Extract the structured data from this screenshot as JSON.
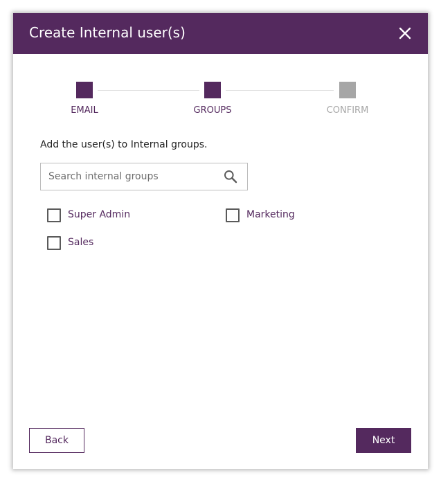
{
  "dialog": {
    "title": "Create Internal user(s)"
  },
  "stepper": {
    "steps": [
      {
        "label": "EMAIL",
        "state": "complete"
      },
      {
        "label": "GROUPS",
        "state": "active"
      },
      {
        "label": "CONFIRM",
        "state": "pending"
      }
    ]
  },
  "content": {
    "instruction": "Add the user(s) to Internal groups.",
    "search": {
      "placeholder": "Search internal groups",
      "value": ""
    },
    "groups": [
      {
        "label": "Super Admin",
        "checked": false
      },
      {
        "label": "Marketing",
        "checked": false
      },
      {
        "label": "Sales",
        "checked": false
      }
    ]
  },
  "footer": {
    "back_label": "Back",
    "next_label": "Next"
  },
  "colors": {
    "brand": "#54295e",
    "pending": "#a6a6a6",
    "line": "#dedede"
  },
  "icons": {
    "close": "close-icon",
    "search": "search-icon"
  }
}
